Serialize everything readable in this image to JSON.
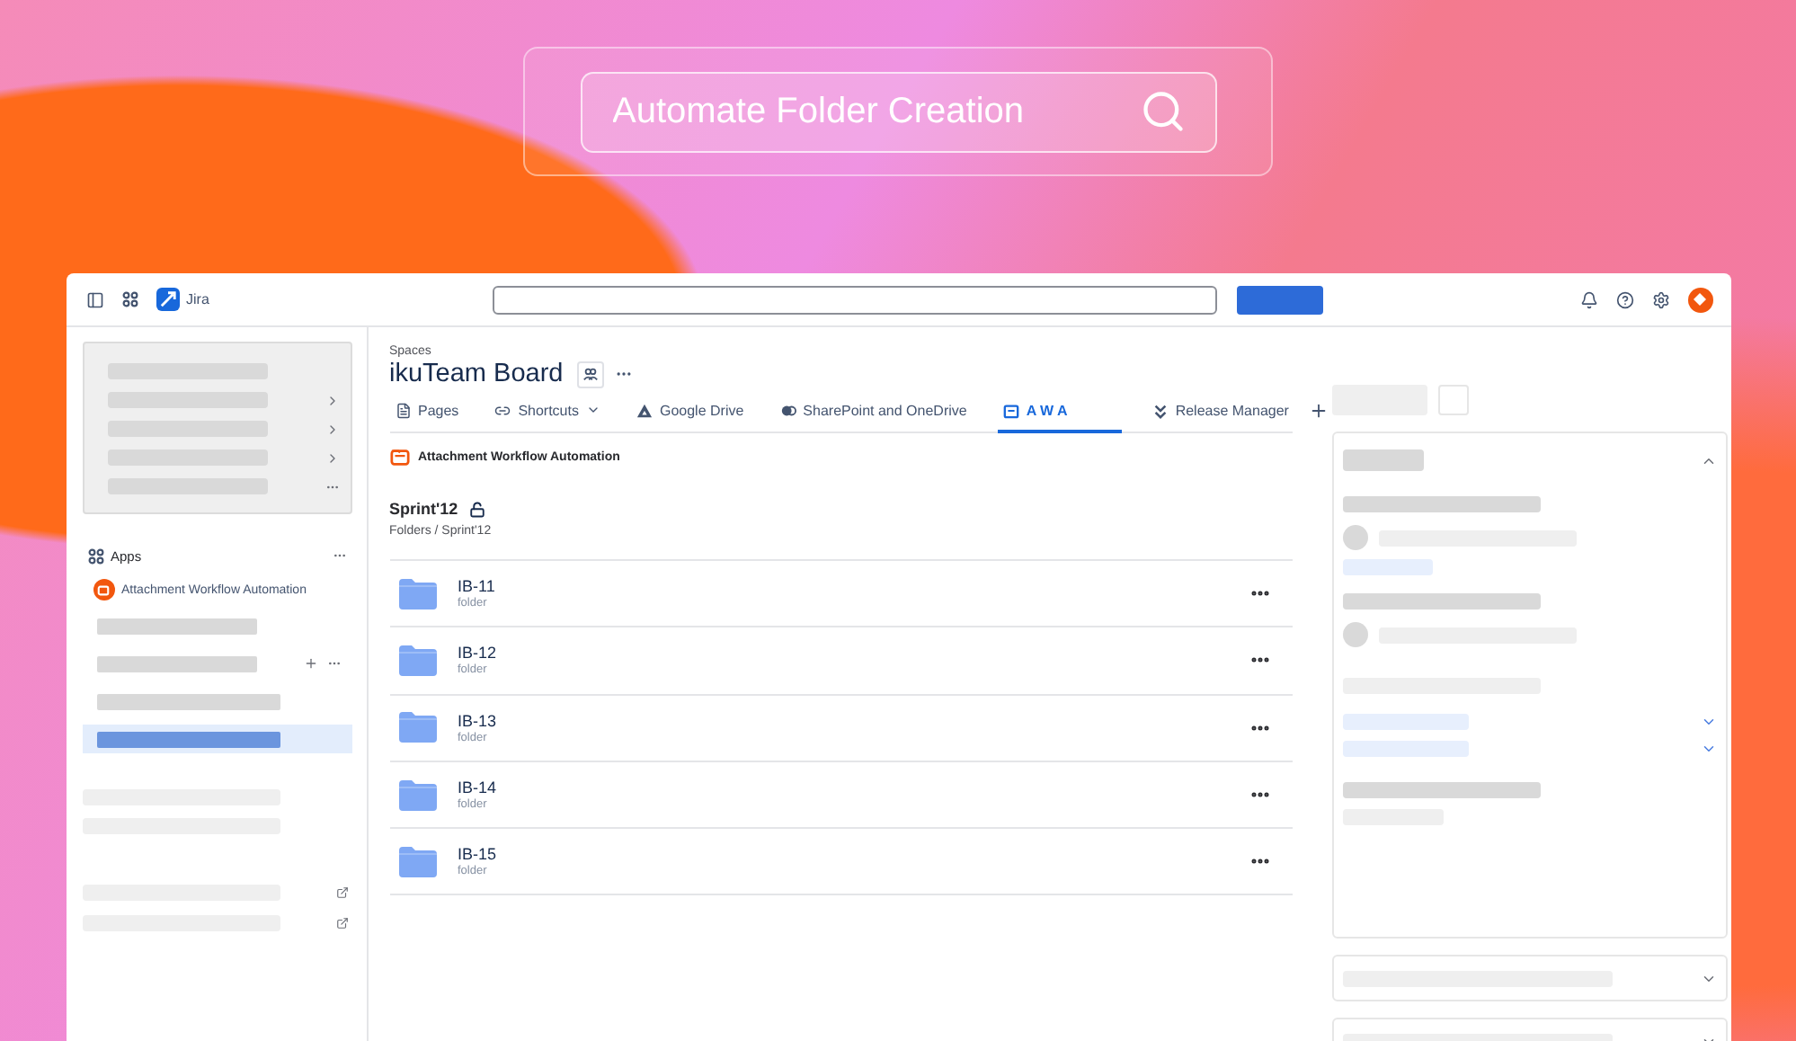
{
  "hero_search": {
    "value": "Automate Folder Creation"
  },
  "topbar": {
    "product": "Jira"
  },
  "sidebar": {
    "apps_heading": "Apps",
    "app": "Attachment Workflow Automation",
    "app_rows": [
      {
        "selected": false
      },
      {
        "selected": false
      },
      {
        "selected": false
      },
      {
        "selected": true
      }
    ]
  },
  "space": {
    "breadcrumb": "Spaces",
    "title": "ikuTeam Board"
  },
  "tabs": [
    {
      "label": "Pages",
      "dropdown": false,
      "selected": false
    },
    {
      "label": "Shortcuts",
      "dropdown": true,
      "selected": false
    },
    {
      "label": "Google Drive",
      "dropdown": false,
      "selected": false
    },
    {
      "label": "SharePoint and OneDrive",
      "dropdown": false,
      "selected": false
    },
    {
      "label": "A W A",
      "dropdown": false,
      "selected": true
    },
    {
      "label": "Release Manager",
      "dropdown": false,
      "selected": false
    }
  ],
  "app_header": "Attachment Workflow Automation",
  "folder_view": {
    "title": "Sprint'12",
    "path": "Folders / Sprint'12",
    "folders": [
      {
        "name": "IB-11",
        "type": "folder"
      },
      {
        "name": "IB-12",
        "type": "folder"
      },
      {
        "name": "IB-13",
        "type": "folder"
      },
      {
        "name": "IB-14",
        "type": "folder"
      },
      {
        "name": "IB-15",
        "type": "folder"
      }
    ]
  }
}
